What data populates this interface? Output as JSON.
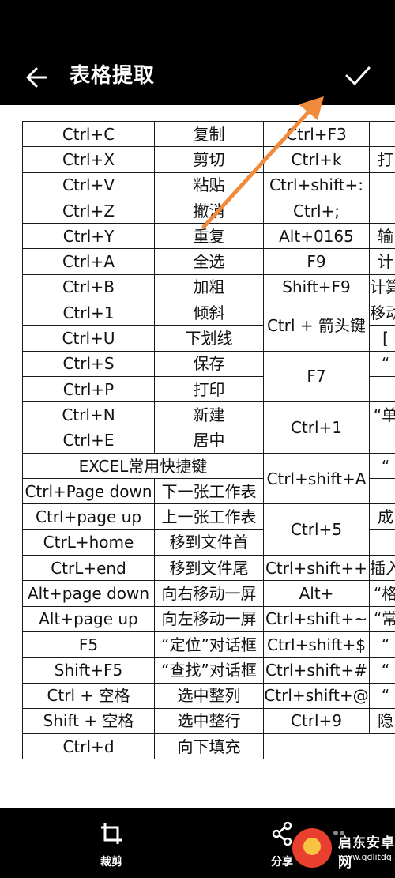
{
  "header": {
    "title": "表格提取"
  },
  "table": {
    "rows": [
      [
        "Ctrl+C",
        "复制",
        "Ctrl+F3",
        ""
      ],
      [
        "Ctrl+X",
        "剪切",
        "Ctrl+k",
        "打"
      ],
      [
        "Ctrl+V",
        "粘贴",
        "Ctrl+shift+:",
        ""
      ],
      [
        "Ctrl+Z",
        "撤消",
        "Ctrl+;",
        ""
      ],
      [
        "Ctrl+Y",
        "重复",
        "Alt+0165",
        "输"
      ],
      [
        "Ctrl+A",
        "全选",
        "F9",
        "计"
      ],
      [
        "Ctrl+B",
        "加粗",
        "Shift+F9",
        "计算"
      ],
      [
        "Ctrl+1",
        "倾斜",
        "Ctrl + 箭头键",
        "移动"
      ],
      [
        "Ctrl+U",
        "下划线",
        "",
        "[ "
      ],
      [
        "Ctrl+S",
        "保存",
        "F7",
        "“"
      ],
      [
        "Ctrl+P",
        "打印",
        "",
        ""
      ],
      [
        "Ctrl+N",
        "新建",
        "Ctrl+1",
        "“单"
      ],
      [
        "Ctrl+E",
        "居中",
        "",
        ""
      ],
      [
        "EXCEL常用快捷键",
        "",
        "Ctrl+shift+A",
        "“"
      ],
      [
        "Ctrl+Page down",
        "下一张工作表",
        "",
        ""
      ],
      [
        "Ctrl+page up",
        "上一张工作表",
        "Ctrl+5",
        "成"
      ],
      [
        "CtrL+home",
        "移到文件首",
        "",
        ""
      ],
      [
        "CtrL+end",
        "移到文件尾",
        "Ctrl+shift++",
        "插入"
      ],
      [
        "Alt+page down",
        "向右移动一屏",
        "Alt+",
        "“格"
      ],
      [
        "Alt+page up",
        "向左移动一屏",
        "Ctrl+shift+~",
        "“常"
      ],
      [
        "F5",
        "“定位”对话框",
        "Ctrl+shift+$",
        "“"
      ],
      [
        "Shift+F5",
        "“查找”对话框",
        "Ctrl+shift+#",
        "“"
      ],
      [
        "Ctrl + 空格",
        "选中整列",
        "Ctrl+shift+@",
        "“"
      ],
      [
        "Shift + 空格",
        "选中整行",
        "Ctrl+9",
        "隐"
      ],
      [
        "Ctrl+d",
        "向下填充",
        "",
        ""
      ]
    ]
  },
  "toolbar": {
    "crop_label": "裁剪",
    "share_label": "分享"
  },
  "watermark": {
    "name": "启东安卓网",
    "url": "www.qdlitdq.com"
  },
  "colors": {
    "bar": "#000000",
    "sheet": "#ffffff",
    "arrow": "#f08a3c"
  }
}
